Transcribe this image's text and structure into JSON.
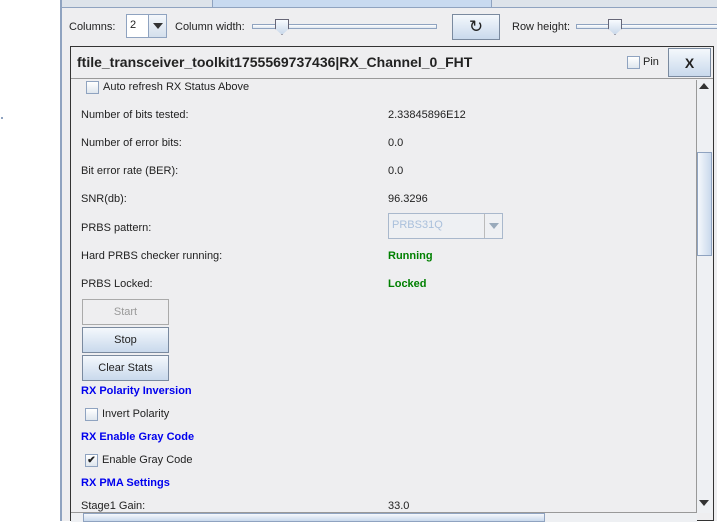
{
  "toolbar": {
    "columns_label": "Columns:",
    "columns_value": "2",
    "column_width_label": "Column width:",
    "row_height_label": "Row height:",
    "column_width_fraction": 0.16,
    "row_height_fraction": 0.3
  },
  "panel": {
    "title": "ftile_transceiver_toolkit1755569737436|RX_Channel_0_FHT",
    "pin_label": "Pin",
    "close_label": "X"
  },
  "content": {
    "auto_refresh_label": "Auto refresh RX Status Above",
    "rows": [
      {
        "label": "Number of bits tested:",
        "value": "2.33845896E12"
      },
      {
        "label": "Number of error bits:",
        "value": "0.0"
      },
      {
        "label": "Bit error rate (BER):",
        "value": "0.0"
      },
      {
        "label": "SNR(db):",
        "value": "96.3296"
      }
    ],
    "prbs_label": "PRBS pattern:",
    "prbs_value": "PRBS31Q",
    "checker_label": "Hard PRBS checker running:",
    "checker_value": "Running",
    "locked_label": "PRBS Locked:",
    "locked_value": "Locked",
    "start_label": "Start",
    "stop_label": "Stop",
    "clear_label": "Clear Stats",
    "polarity_header": "RX Polarity Inversion",
    "invert_label": "Invert Polarity",
    "gray_header": "RX Enable Gray Code",
    "gray_label": "Enable Gray Code",
    "gray_check": "✔",
    "pma_header": "RX PMA Settings",
    "stage1_label": "Stage1 Gain:",
    "stage1_value": "33.0"
  },
  "icons": {
    "refresh": "↻"
  }
}
